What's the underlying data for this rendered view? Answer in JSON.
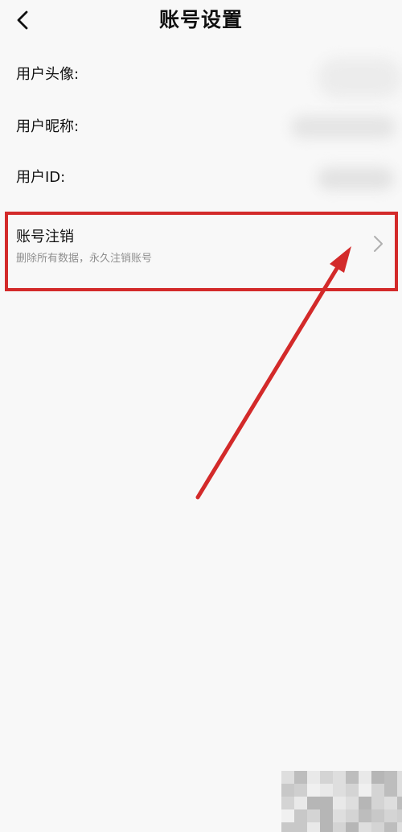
{
  "header": {
    "title": "账号设置"
  },
  "rows": {
    "avatar_label": "用户头像:",
    "nickname_label": "用户昵称:",
    "id_label": "用户ID:"
  },
  "delete_account": {
    "title": "账号注销",
    "subtitle": "删除所有数据，永久注销账号"
  },
  "icons": {
    "back": "chevron-left-icon",
    "forward": "chevron-right-icon"
  },
  "colors": {
    "highlight": "#d32a2a",
    "background": "#f8f8f8",
    "subtitle": "#8f8f8f"
  }
}
